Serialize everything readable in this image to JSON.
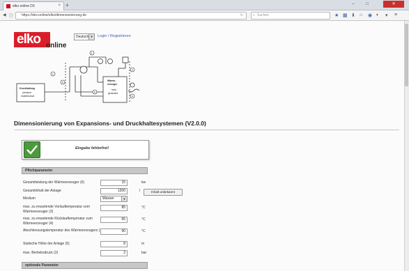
{
  "browser": {
    "tab_title": "elko online D3",
    "url": "https://dev.online/elko/dimensionierung.de",
    "search_placeholder": "Suchen",
    "new_tab_symbol": "+",
    "close_symbol": "×"
  },
  "header": {
    "logo_text": "elko",
    "logo_sub": "online",
    "language_selected": "Deutsch",
    "login_link": "Login / Registrieren"
  },
  "schematic": {
    "label_left_title": "Druckhaltung",
    "label_left_sub1": "pressure",
    "label_left_sub2": "maintenance",
    "label_right_title1": "Wärme-",
    "label_right_title2": "erzeuger",
    "label_right_sub1": "heat",
    "label_right_sub2": "generator",
    "markers": [
      "1",
      "2",
      "3",
      "4",
      "5",
      "6"
    ]
  },
  "page": {
    "title": "Dimensionierung von Expansions- und Druckhaltesystemen (V2.0.0)",
    "status_text": "Eingabe fehlerfrei!"
  },
  "sections": {
    "required_title": "Pflichtparameter",
    "optional_title": "optionale Parameter"
  },
  "fields": [
    {
      "label": "Gesamtleistung der Wärmeerzeuger (6)",
      "value": "15",
      "unit": "kw"
    },
    {
      "label": "Gesamtinhalt der Anlage",
      "value": "1200",
      "unit": "l"
    },
    {
      "label": "Medium",
      "value": "Wasser",
      "unit": ""
    },
    {
      "label": "max. zu erwartende Vorlauftemperatur vom Wärmeerzeuger (3)",
      "value": "85",
      "unit": "°C"
    },
    {
      "label": "max. zu erwartende Rücklauftemperatur zum Wärmeerzeuger (4)",
      "value": "65",
      "unit": "°C"
    },
    {
      "label": "Abschlenzungstemperatur des Wärmeerzeugers (1)",
      "value": "90",
      "unit": "°C"
    },
    {
      "label": "Statische Höhe der Anlage (5)",
      "value": "8",
      "unit": "m"
    },
    {
      "label": "max. Betriebsdruck (2)",
      "value": "3",
      "unit": "bar"
    }
  ],
  "buttons": {
    "content_unknown": "Inhalt unbekannt"
  },
  "colors": {
    "brand_red": "#d91e2a",
    "status_green": "#4c9a3c",
    "link_blue": "#3a5fb0"
  }
}
